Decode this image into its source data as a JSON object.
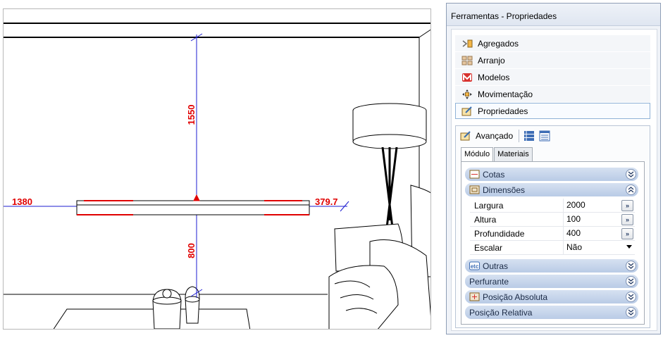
{
  "viewport": {
    "dimensions": {
      "top_height": "1550",
      "bottom_height": "800",
      "left_distance": "1380",
      "right_distance": "379.7"
    }
  },
  "panel": {
    "title": "Ferramentas - Propriedades",
    "nav": [
      {
        "label": "Agregados",
        "icon": "aggregates-icon"
      },
      {
        "label": "Arranjo",
        "icon": "arrangement-icon"
      },
      {
        "label": "Modelos",
        "icon": "models-icon"
      },
      {
        "label": "Movimentação",
        "icon": "move-icon"
      },
      {
        "label": "Propriedades",
        "icon": "properties-icon",
        "active": true
      }
    ],
    "toolbar": {
      "advanced_label": "Avançado"
    },
    "tabs": [
      {
        "label": "Módulo",
        "active": true
      },
      {
        "label": "Materiais",
        "active": false
      }
    ],
    "groups": {
      "cotas": {
        "label": "Cotas",
        "state": "collapsed"
      },
      "dimensoes": {
        "label": "Dimensões",
        "state": "expanded"
      },
      "outras": {
        "label": "Outras",
        "state": "collapsed"
      },
      "perfurante": {
        "label": "Perfurante",
        "state": "collapsed"
      },
      "posicao_absoluta": {
        "label": "Posição Absoluta",
        "state": "collapsed"
      },
      "posicao_relativa": {
        "label": "Posição Relativa",
        "state": "collapsed"
      }
    },
    "dimensoes_props": [
      {
        "name": "Largura",
        "value": "2000",
        "control": "button",
        "button_label": "»"
      },
      {
        "name": "Altura",
        "value": "100",
        "control": "button",
        "button_label": "»"
      },
      {
        "name": "Profundidade",
        "value": "400",
        "control": "button",
        "button_label": "»"
      },
      {
        "name": "Escalar",
        "value": "Não",
        "control": "dropdown"
      }
    ],
    "colors": {
      "accent": "#8fb2d7",
      "group_fill": "#c7d6ec",
      "dimension_red": "#e00000"
    }
  }
}
